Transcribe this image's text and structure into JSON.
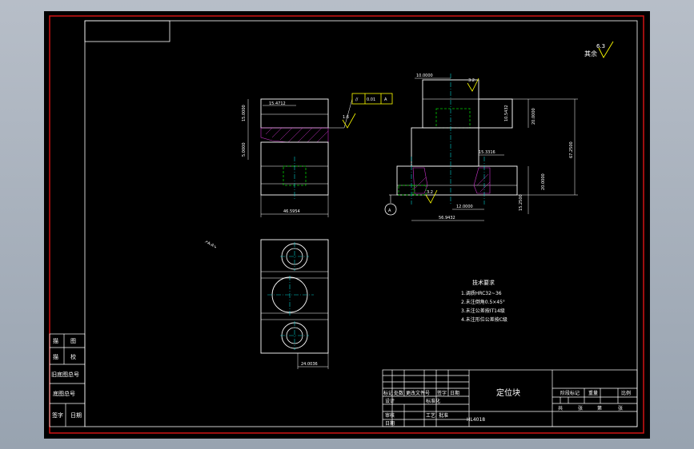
{
  "drawing": {
    "title": "定位块",
    "roughness_general": {
      "value": "6.3",
      "label": "其余"
    },
    "roughness_top": "3.2",
    "roughness_bottom": "3.2",
    "roughness_mid": "1.6",
    "datum_label": "A",
    "tolerance_frame": [
      "//",
      "0.01",
      "A"
    ],
    "leader_label": "↗A-A↘",
    "tech_requirements": {
      "title": "技术要求",
      "items": [
        "1.调质HRC32~36",
        "2.未注倒角0.5×45°",
        "3.未注公差按IT14级",
        "4.未注形位公差按C级"
      ]
    },
    "dimensions": {
      "top_width_small": "15.4712",
      "left_h1": "15.0000",
      "left_h2": "5.0000",
      "left_bottom_width": "46.5954",
      "right_top_width": "10.0000",
      "right_h_a": "10.5432",
      "right_h_b": "20.0000",
      "right_total_h": "67.2500",
      "right_small_w": "15.3316",
      "right_h_c": "20.0000",
      "right_h_d": "15.2500",
      "right_mid_w": "12.0000",
      "right_bottom_w": "56.9432",
      "plan_width": "24.0036"
    },
    "left_table": {
      "rows": [
        [
          "描",
          "图"
        ],
        [
          "描",
          "校"
        ],
        [
          "旧底图总号",
          ""
        ],
        [
          "底图总号",
          ""
        ],
        [
          "签字",
          "日期"
        ]
      ]
    },
    "title_block": {
      "sheet_info": [
        "标记",
        "处数",
        "更改文件号",
        "签字",
        "日期"
      ],
      "design": "设计",
      "check": "审核",
      "std": "标准化",
      "approve": "批准",
      "process": "工艺",
      "date": "日期",
      "right_labels": [
        "阶段标记",
        "重量",
        "比例"
      ],
      "right_bottom": [
        "共",
        "张",
        "第",
        "张"
      ],
      "code": "HL4018"
    }
  }
}
